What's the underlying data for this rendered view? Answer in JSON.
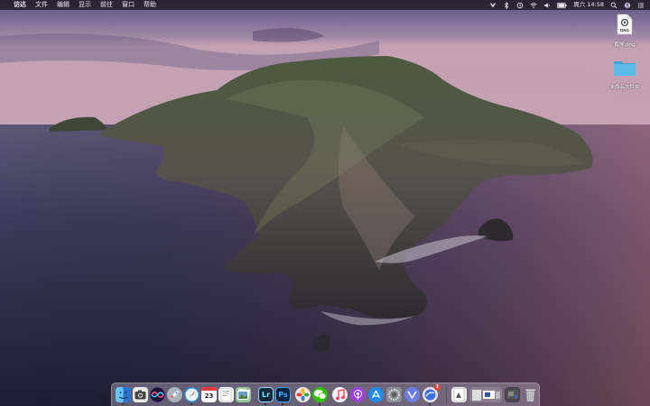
{
  "menubar": {
    "apple_glyph": "",
    "items": [
      "访达",
      "文件",
      "编辑",
      "显示",
      "前往",
      "窗口",
      "帮助"
    ],
    "status": {
      "clock": "周六 14:58"
    }
  },
  "desktop": {
    "icons": [
      {
        "name": "dng-file",
        "badge": "DNG",
        "label": "截屏.dng"
      },
      {
        "name": "folder",
        "label": "未命名文件夹"
      }
    ]
  },
  "dock": {
    "apps": [
      {
        "name": "finder",
        "icon": "finder-icon",
        "color": "#3a8ee6",
        "running": true
      },
      {
        "name": "image-capture",
        "icon": "camera-icon",
        "color": "#e9e9ea",
        "running": false
      },
      {
        "name": "siri",
        "icon": "siri-icon",
        "color": "#5b3cc4",
        "running": false
      },
      {
        "name": "launchpad",
        "icon": "rocket-icon",
        "color": "#a9b2bd",
        "running": false
      },
      {
        "name": "safari",
        "icon": "compass-icon",
        "color": "#2f87d9",
        "running": true
      },
      {
        "name": "calendar",
        "icon": "calendar-icon",
        "color": "#ffffff",
        "text": "23",
        "running": false
      },
      {
        "name": "textedit",
        "icon": "document-icon",
        "color": "#f4f4f2",
        "running": false
      },
      {
        "name": "preview",
        "icon": "photos-stack-icon",
        "color": "#9dc6a0",
        "running": false
      },
      {
        "name": "lightroom",
        "icon": "lightroom-icon",
        "color": "#0c2a3a",
        "text": "Lr",
        "running": true
      },
      {
        "name": "photoshop",
        "icon": "photoshop-icon",
        "color": "#0b2240",
        "text": "Ps",
        "running": true
      },
      {
        "name": "photos",
        "icon": "photos-icon",
        "color": "#f1e8dc",
        "running": false
      },
      {
        "name": "wechat",
        "icon": "wechat-icon",
        "color": "#2dc100",
        "running": true
      },
      {
        "name": "music",
        "icon": "music-icon",
        "color": "#f3f1f4",
        "running": false
      },
      {
        "name": "podcasts",
        "icon": "podcasts-icon",
        "color": "#9b43d8",
        "running": false
      },
      {
        "name": "app-store",
        "icon": "app-store-icon",
        "color": "#1e8cf0",
        "running": false
      },
      {
        "name": "system-preferences",
        "icon": "gear-icon",
        "color": "#8c8f93",
        "running": false
      },
      {
        "name": "feedback",
        "icon": "feedback-icon",
        "color": "#6a7ee6",
        "running": false
      },
      {
        "name": "chrome-like",
        "icon": "browser-icon",
        "color": "#e8e3f2",
        "badge": "1",
        "running": true
      }
    ],
    "stacks": [
      {
        "name": "recent-doc",
        "icon": "document-stack-icon"
      },
      {
        "name": "downloads-stack",
        "icon": "downloads-stack-icon"
      },
      {
        "name": "screenshots-stack",
        "icon": "screenshots-stack-icon"
      }
    ],
    "trash": {
      "icon": "trash-icon"
    }
  }
}
